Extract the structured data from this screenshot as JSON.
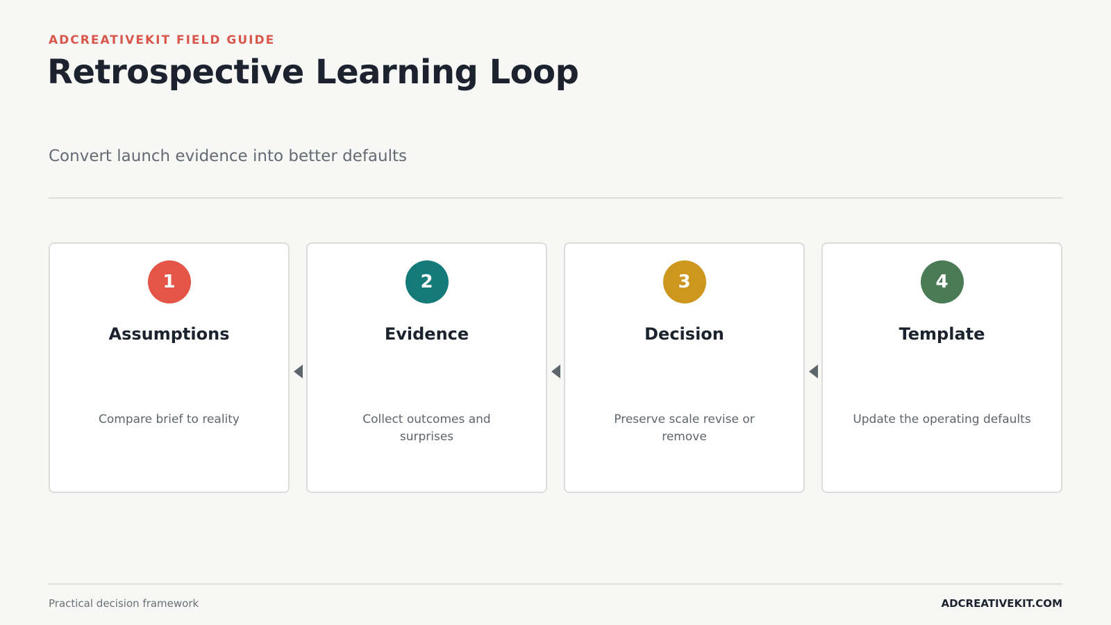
{
  "header": {
    "eyebrow": "ADCREATIVEKIT FIELD GUIDE",
    "title": "Retrospective Learning Loop",
    "subtitle": "Convert launch evidence into better defaults"
  },
  "steps": [
    {
      "number": "1",
      "title": "Assumptions",
      "description": "Compare brief to reality",
      "color": "#e45447"
    },
    {
      "number": "2",
      "title": "Evidence",
      "description": "Collect outcomes and surprises",
      "color": "#147a7a"
    },
    {
      "number": "3",
      "title": "Decision",
      "description": "Preserve scale revise or remove",
      "color": "#cc971c"
    },
    {
      "number": "4",
      "title": "Template",
      "description": "Update the operating defaults",
      "color": "#4b7b55"
    }
  ],
  "connectors": [
    {
      "from": "2",
      "to": "1",
      "icon": "arrow-left-icon"
    },
    {
      "from": "3",
      "to": "2",
      "icon": "arrow-left-icon"
    },
    {
      "from": "4",
      "to": "3",
      "icon": "arrow-left-icon"
    }
  ],
  "footer": {
    "left": "Practical decision framework",
    "right": "ADCREATIVEKIT.COM"
  }
}
